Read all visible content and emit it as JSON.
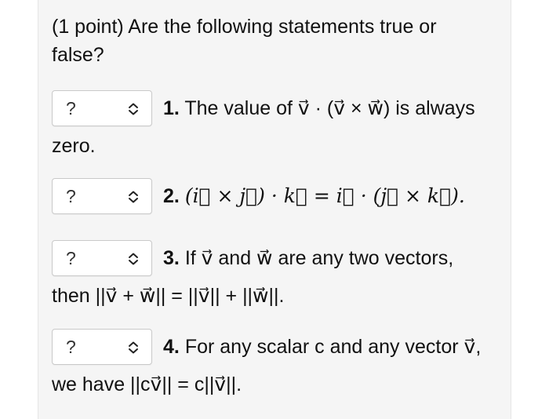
{
  "prompt": "(1 point) Are the following statements true or false?",
  "dropdown_value": "?",
  "questions": [
    {
      "number": "1.",
      "line1": "The value of v⃗ · (v⃗ × w⃗) is always",
      "line2": "zero."
    },
    {
      "number": "2.",
      "line1": "(i⃗ × j⃗) · k⃗ = i⃗ · (j⃗ × k⃗).",
      "line2": ""
    },
    {
      "number": "3.",
      "line1": "If v⃗ and w⃗ are any two vectors,",
      "line2": "then ||v⃗ + w⃗|| = ||v⃗|| + ||w⃗||."
    },
    {
      "number": "4.",
      "line1": "For any scalar c and any vector v⃗,",
      "line2": "we have ||cv⃗|| = c||v⃗||."
    }
  ]
}
